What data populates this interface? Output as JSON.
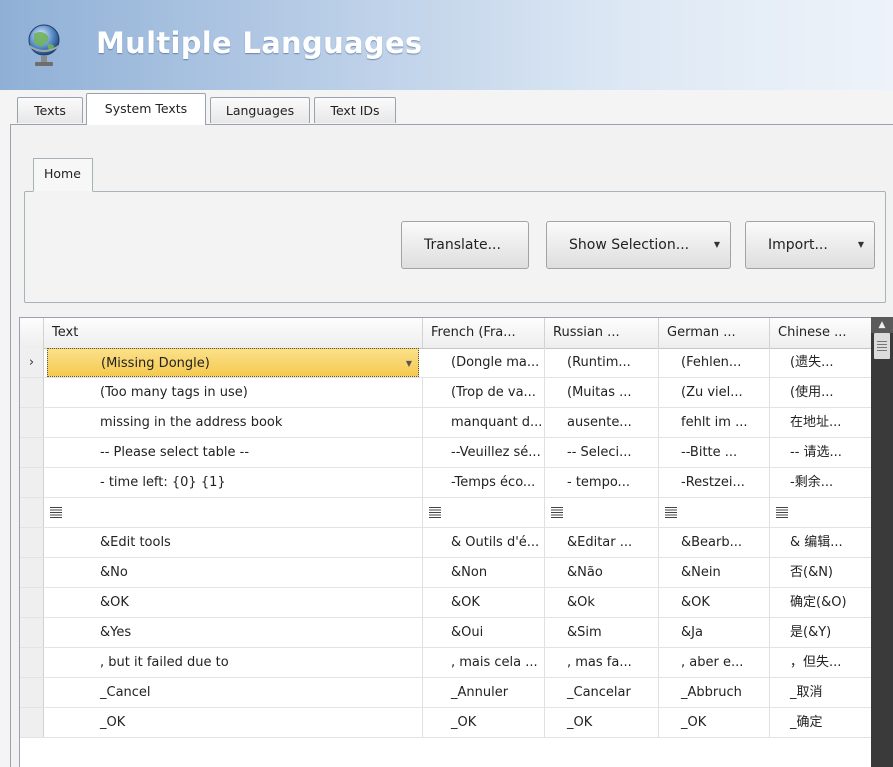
{
  "app": {
    "title": "Multiple Languages"
  },
  "tabs": [
    {
      "label": "Texts"
    },
    {
      "label": "System Texts",
      "active": true
    },
    {
      "label": "Languages"
    },
    {
      "label": "Text IDs"
    }
  ],
  "ribbon": {
    "tab": "Home",
    "buttons": {
      "translate": "Translate...",
      "show_selection": "Show Selection...",
      "import": "Import..."
    }
  },
  "grid": {
    "columns": [
      "Text",
      "French (Fra...",
      "Russian ...",
      "German ...",
      "Chinese ..."
    ],
    "rows": [
      {
        "selected": true,
        "marker": "›",
        "cells": [
          "(Missing Dongle)",
          "(Dongle ma...",
          "(Runtim...",
          "(Fehlen...",
          "(遗失..."
        ]
      },
      {
        "cells": [
          "(Too many tags in use)",
          "(Trop de va...",
          "(Muitas ...",
          "(Zu viel...",
          "(使用..."
        ]
      },
      {
        "cells": [
          "missing in the address book",
          "manquant d...",
          "ausente...",
          "fehlt im ...",
          "在地址..."
        ]
      },
      {
        "cells": [
          "-- Please select table --",
          "--Veuillez sé...",
          "-- Seleci...",
          "--Bitte ...",
          "-- 请选..."
        ]
      },
      {
        "cells": [
          "- time left: {0} {1}",
          "-Temps éco...",
          "- tempo...",
          "-Restzei...",
          "-剩余..."
        ]
      },
      {
        "multiline": true,
        "cells": [
          "",
          "",
          "",
          "",
          ""
        ]
      },
      {
        "cells": [
          "&Edit tools",
          "& Outils d'é...",
          "&Editar ...",
          "&Bearb...",
          "& 编辑..."
        ]
      },
      {
        "cells": [
          "&No",
          "&Non",
          "&Não",
          "&Nein",
          "否(&N)"
        ]
      },
      {
        "cells": [
          "&OK",
          "&OK",
          "&Ok",
          "&OK",
          "确定(&O)"
        ]
      },
      {
        "cells": [
          "&Yes",
          "&Oui",
          "&Sim",
          "&Ja",
          "是(&Y)"
        ]
      },
      {
        "cells": [
          ", but it failed due to",
          ", mais cela ...",
          ", mas fa...",
          ", aber e...",
          "，但失..."
        ]
      },
      {
        "cells": [
          "_Cancel",
          "_Annuler",
          "_Cancelar",
          "_Abbruch",
          "_取消"
        ]
      },
      {
        "cells": [
          "_OK",
          "_OK",
          "_OK",
          "_OK",
          "_确定"
        ]
      }
    ]
  },
  "colors": {
    "header_start": "#8fb0d6",
    "selection": "#f5c94f",
    "scrollbar": "#3a3a3a"
  },
  "icons": {
    "app": "globe-icon",
    "row_marker": "row-pointer-icon",
    "dropdown": "chevron-down-icon"
  }
}
